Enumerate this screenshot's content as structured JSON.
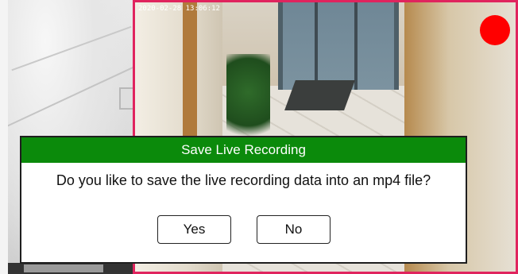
{
  "camera_left": {
    "label": ""
  },
  "camera_right": {
    "timestamp": "2020-02-28 13:06:12",
    "recording_indicator_color": "#ff0000",
    "border_color": "#e0245e"
  },
  "dialog": {
    "title": "Save Live Recording",
    "message": "Do you like to save the live recording data into an mp4 file?",
    "header_color": "#0b8a0b",
    "buttons": {
      "yes_label": "Yes",
      "no_label": "No"
    }
  }
}
